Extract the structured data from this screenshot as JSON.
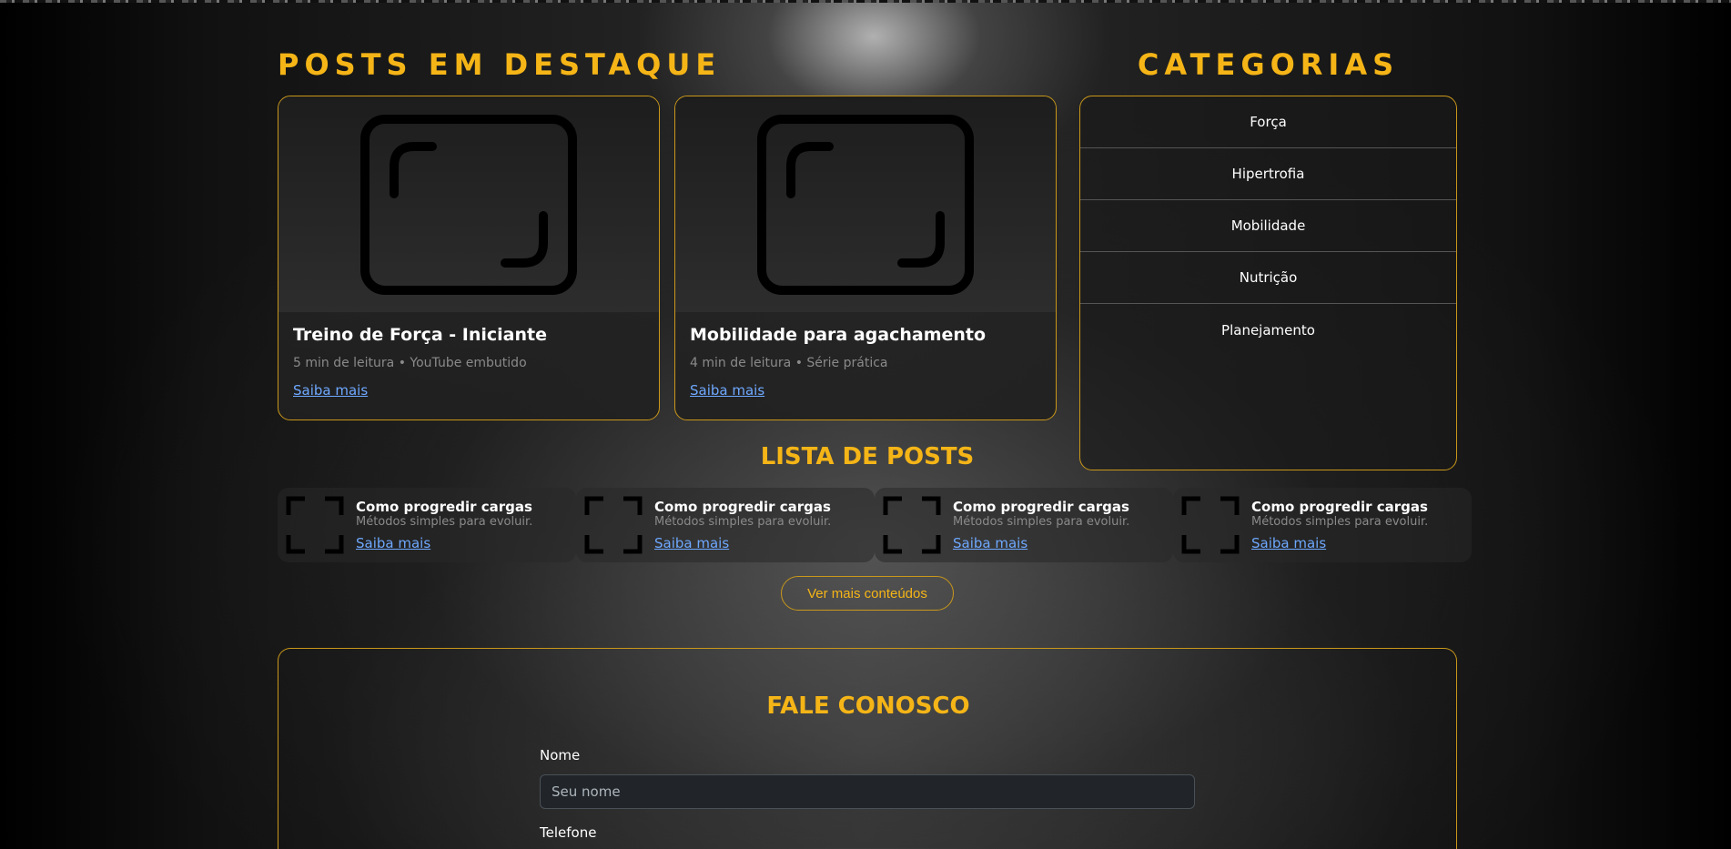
{
  "featured": {
    "title": "POSTS EM DESTAQUE",
    "cards": [
      {
        "title": "Treino de Força - Iniciante",
        "meta": "5 min de leitura • YouTube embutido",
        "link": "Saiba mais",
        "image_icon": "image-placeholder-icon"
      },
      {
        "title": "Mobilidade para agachamento",
        "meta": "4 min de leitura • Série prática",
        "link": "Saiba mais",
        "image_icon": "image-placeholder-icon"
      }
    ]
  },
  "categories": {
    "title": "CATEGORIAS",
    "items": [
      "Força",
      "Hipertrofia",
      "Mobilidade",
      "Nutrição",
      "Planejamento"
    ]
  },
  "post_list": {
    "title": "LISTA DE POSTS",
    "items": [
      {
        "title": "Como progredir cargas",
        "subtitle": "Métodos simples para evoluir.",
        "link": "Saiba mais"
      },
      {
        "title": "Como progredir cargas",
        "subtitle": "Métodos simples para evoluir.",
        "link": "Saiba mais"
      },
      {
        "title": "Como progredir cargas",
        "subtitle": "Métodos simples para evoluir.",
        "link": "Saiba mais"
      },
      {
        "title": "Como progredir cargas",
        "subtitle": "Métodos simples para evoluir.",
        "link": "Saiba mais"
      }
    ],
    "more_button": "Ver mais conteúdos"
  },
  "contact": {
    "title": "FALE CONOSCO",
    "name_label": "Nome",
    "name_placeholder": "Seu nome",
    "name_value": "",
    "phone_label": "Telefone"
  },
  "colors": {
    "accent": "#f5b517",
    "border": "#c9971a",
    "link": "#6ea8fe",
    "muted_text": "#8a8a8a"
  }
}
